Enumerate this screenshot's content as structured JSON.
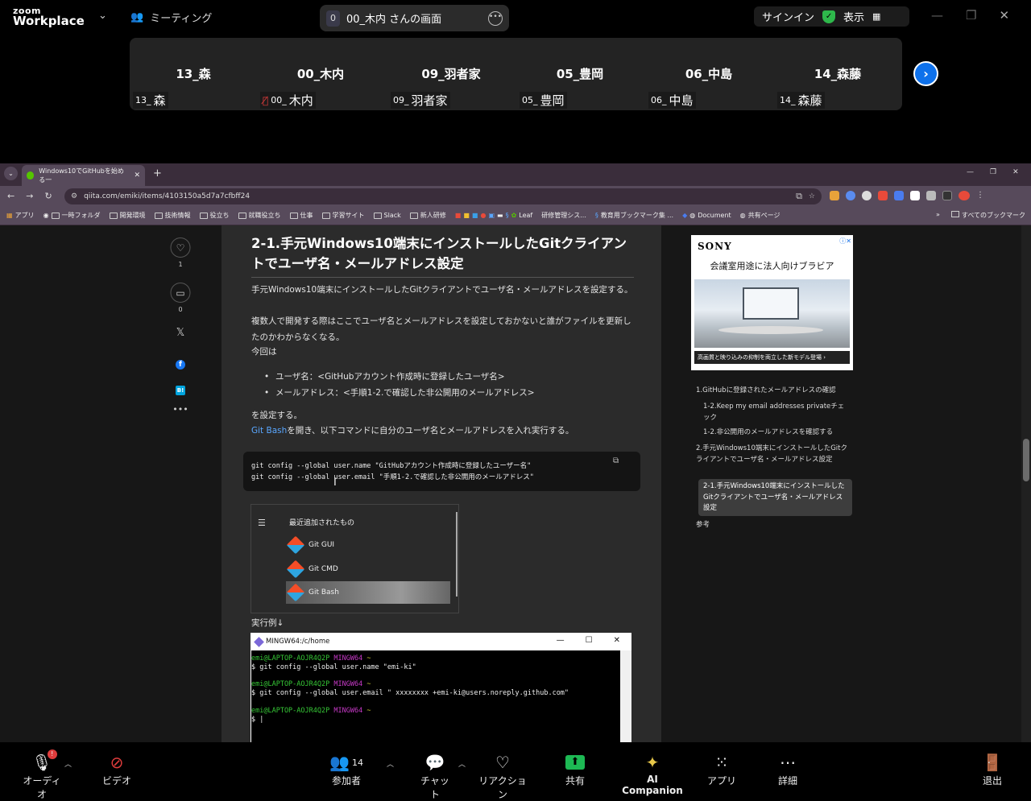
{
  "zoom": {
    "logo_line1": "zoom",
    "logo_line2": "Workplace",
    "meetings_label": "ミーティング",
    "share_count": "0",
    "share_title": "00_木内 さんの画面",
    "signin_label": "サインイン",
    "view_label": "表示"
  },
  "participants": [
    {
      "name": "13_森",
      "label_prefix": "13_",
      "label_name": "森",
      "muted": false
    },
    {
      "name": "00_木内",
      "label_prefix": "00_",
      "label_name": "木内",
      "muted": true
    },
    {
      "name": "09_羽者家",
      "label_prefix": "09_",
      "label_name": "羽者家",
      "muted": false
    },
    {
      "name": "05_豊岡",
      "label_prefix": "05_",
      "label_name": "豊岡",
      "muted": false
    },
    {
      "name": "06_中島",
      "label_prefix": "06_",
      "label_name": "中島",
      "muted": false
    },
    {
      "name": "14_森藤",
      "label_prefix": "14_",
      "label_name": "森藤",
      "muted": false
    }
  ],
  "browser": {
    "tab_title": "Windows10でGitHubを始める一",
    "url": "qiita.com/emiki/items/4103150a5d7a7cfbff24",
    "bookmarks": [
      "アプリ",
      "一時フォルダ",
      "開発環境",
      "技術情報",
      "役立ち",
      "就職役立ち",
      "仕事",
      "学習サイト",
      "Slack",
      "新人研修",
      "Leaf",
      "研修管理シス...",
      "教育用ブックマーク集 ...",
      "Document",
      "共有ページ"
    ],
    "all_bookmarks": "すべてのブックマーク"
  },
  "article": {
    "like_count": "1",
    "stock_count": "0",
    "heading": "2-1.手元Windows10端末にインストールしたGitクライアントでユーザ名・メールアドレス設定",
    "para1": "手元Windows10端末にインストールしたGitクライアントでユーザ名・メールアドレスを設定する。",
    "para2": "複数人で開発する際はここでユーザ名とメールアドレスを設定しておかないと誰がファイルを更新したのかわからなくなる。",
    "para3": "今回は",
    "bullet1": "ユーザ名：<GitHubアカウント作成時に登録したユーザ名>",
    "bullet2": "メールアドレス：<手順1-2.で確認した非公開用のメールアドレス>",
    "para4": "を設定する。",
    "para5_link": "Git Bash",
    "para5_rest": "を開き、以下コマンドに自分のユーザ名とメールアドレスを入れ実行する。",
    "code_line1": "git config --global user.name \"GitHubアカウント作成時に登録したユーザー名\"",
    "code_line2": "git config --global user.email \"手順1-2.で確認した非公開用のメールアドレス\"",
    "startmenu_header": "最近追加されたもの",
    "startmenu_items": [
      "Git GUI",
      "Git CMD",
      "Git Bash"
    ],
    "example_label": "実行例↓",
    "terminal_title": "MINGW64:/c/home",
    "term_user": "emi@LAPTOP-AOJR4Q2P",
    "term_env": "MINGW64",
    "term_dir": "~",
    "term_cmd1": "$ git config --global user.name \"emi-ki\"",
    "term_cmd2": "$ git config --global user.email \" xxxxxxxx +emi-ki@users.noreply.github.com\"",
    "term_prompt": "$ |"
  },
  "ad": {
    "brand": "SONY",
    "headline": "会議室用途に法人向けブラビア",
    "caption": "高画質と映り込みの抑制を両立した新モデル登場 ›"
  },
  "toc": [
    "1.GitHubに登録されたメールアドレスの確認",
    "1-2.Keep my email addresses privateチェック",
    "1-2.非公開用のメールアドレスを確認する",
    "2.手元Windows10端末にインストールしたGitクライアントでユーザ名・メールアドレス設定",
    "2-1.手元Windows10端末にインストールしたGitクライアントでユーザ名・メールアドレス設定",
    "参考"
  ],
  "toolbar": {
    "audio": "オーディオ",
    "audio_badge": "!",
    "video": "ビデオ",
    "participants": "参加者",
    "participants_count": "14",
    "chat": "チャット",
    "reactions": "リアクション",
    "share": "共有",
    "ai_companion": "AI Companion",
    "apps": "アプリ",
    "more": "詳細",
    "leave": "退出"
  },
  "colors": {
    "accent": "#0e71eb",
    "share_green": "#1db954",
    "qiita_green": "#55c500",
    "leave_red": "#e03c3c"
  }
}
